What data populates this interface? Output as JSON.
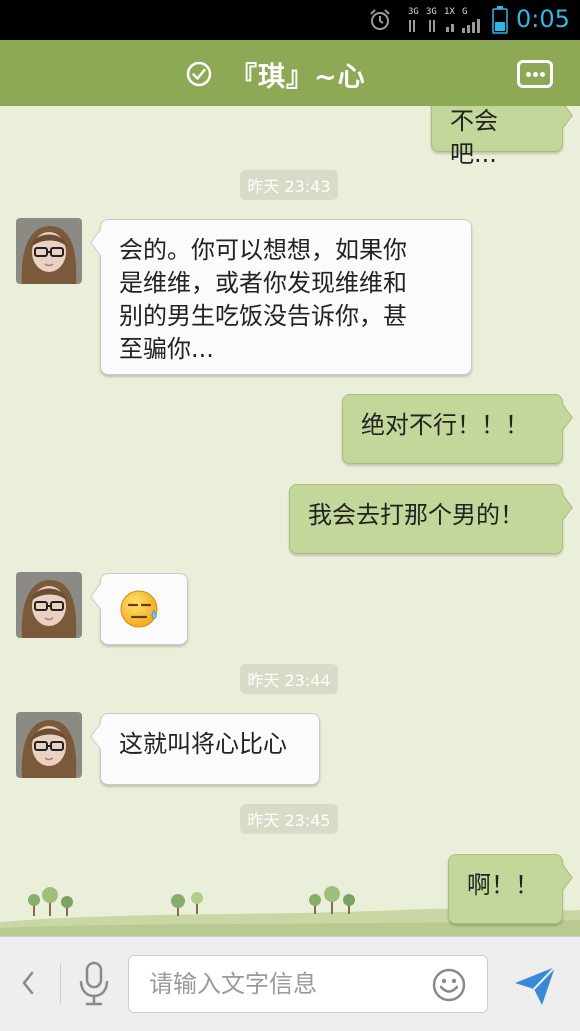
{
  "status_bar": {
    "time": "0:05",
    "network_labels": [
      "3G",
      "3G",
      "1X",
      "G"
    ]
  },
  "header": {
    "title": "『琪』~心"
  },
  "input": {
    "placeholder": "请输入文字信息"
  },
  "messages": [
    {
      "type": "out",
      "text": "不会吧..."
    },
    {
      "type": "timestamp",
      "text": "昨天 23:43"
    },
    {
      "type": "in",
      "lines": [
        "会的。你可以想想，如果你",
        "是维维，或者你发现维维和",
        "别的男生吃饭没告诉你，甚",
        "至骗你..."
      ]
    },
    {
      "type": "out",
      "text": "绝对不行！！！"
    },
    {
      "type": "out",
      "text": "我会去打那个男的！"
    },
    {
      "type": "in",
      "emoji": "sweat-unamused-emoji"
    },
    {
      "type": "timestamp",
      "text": "昨天 23:44"
    },
    {
      "type": "in",
      "text": "这就叫将心比心"
    },
    {
      "type": "timestamp",
      "text": "昨天 23:45"
    },
    {
      "type": "out",
      "text": "啊！！"
    }
  ],
  "colors": {
    "title_bar": "#8da956",
    "chat_background": "#e9efd8",
    "outgoing_bubble": "#c3d79a",
    "incoming_bubble": "#fbfbfb",
    "status_time": "#33b5e5",
    "send_icon": "#3a88d6"
  },
  "icons": [
    "alarm-icon",
    "signal-icon",
    "battery-icon",
    "verified-check-icon",
    "more-icon",
    "back-arrow-icon",
    "microphone-icon",
    "smiley-icon",
    "send-icon"
  ]
}
